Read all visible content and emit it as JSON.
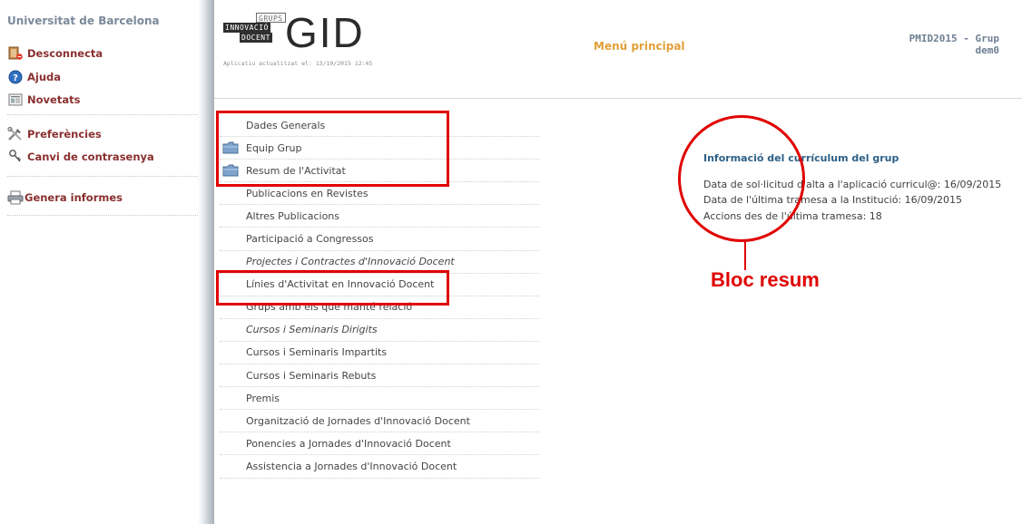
{
  "sidebar": {
    "title": "Universitat de Barcelona",
    "links": [
      {
        "label": "Desconnecta",
        "icon": "logout-icon"
      },
      {
        "label": "Ajuda",
        "icon": "help-icon"
      },
      {
        "label": "Novetats",
        "icon": "news-icon"
      },
      {
        "label": "Preferències",
        "icon": "tools-icon"
      },
      {
        "label": "Canvi de contrasenya",
        "icon": "key-icon"
      },
      {
        "label": "Genera informes",
        "icon": "printer-icon"
      }
    ]
  },
  "header": {
    "logo": {
      "line1": "GRUPS",
      "line2": "INNOVACIÓ",
      "line3": "DOCENT",
      "acronym": "GID",
      "updated": "Aplicatiu actualitzat el: 13/10/2015 12:45"
    },
    "menu_principal": "Menú principal",
    "project_line1": "PMID2015 - Grup",
    "project_line2": "dem0"
  },
  "menu": {
    "items": [
      {
        "label": "Dades Generals",
        "folder": false,
        "italic": false
      },
      {
        "label": "Equip Grup",
        "folder": true,
        "italic": false
      },
      {
        "label": "Resum de l'Activitat",
        "folder": true,
        "italic": false
      },
      {
        "label": "Publicacions en Revistes",
        "folder": false,
        "italic": false
      },
      {
        "label": "Altres Publicacions",
        "folder": false,
        "italic": false
      },
      {
        "label": "Participació a Congressos",
        "folder": false,
        "italic": false
      },
      {
        "label": "Projectes i Contractes d'Innovació Docent",
        "folder": false,
        "italic": true
      },
      {
        "label": "Línies d'Activitat en Innovació Docent",
        "folder": false,
        "italic": false
      },
      {
        "label": "Grups amb els que manté relació",
        "folder": false,
        "italic": false
      },
      {
        "label": "Cursos i Seminaris Dirigits",
        "folder": false,
        "italic": true
      },
      {
        "label": "Cursos i Seminaris Impartits",
        "folder": false,
        "italic": false
      },
      {
        "label": "Cursos i Seminaris Rebuts",
        "folder": false,
        "italic": false
      },
      {
        "label": "Premis",
        "folder": false,
        "italic": false
      },
      {
        "label": "Organització de Jornades d'Innovació Docent",
        "folder": false,
        "italic": false
      },
      {
        "label": "Ponencies a Jornades d'Innovació Docent",
        "folder": false,
        "italic": false
      },
      {
        "label": "Assistencia a Jornades d'Innovació Docent",
        "folder": false,
        "italic": false
      }
    ]
  },
  "summary": {
    "title": "Informació del currículum del grup",
    "lines": [
      "Data de sol·licitud d'alta a l'aplicació curricul@: 16/09/2015",
      "Data de l'última tramesa a la Institució: 16/09/2015",
      "Accions des de l'última tramesa: 18"
    ]
  },
  "annotation": {
    "label": "Bloc resum",
    "color": "#e00000"
  },
  "colors": {
    "sidebar_link": "#8a2f2f",
    "menu_principal": "#e1a038",
    "summary_title": "#2c5f86"
  }
}
